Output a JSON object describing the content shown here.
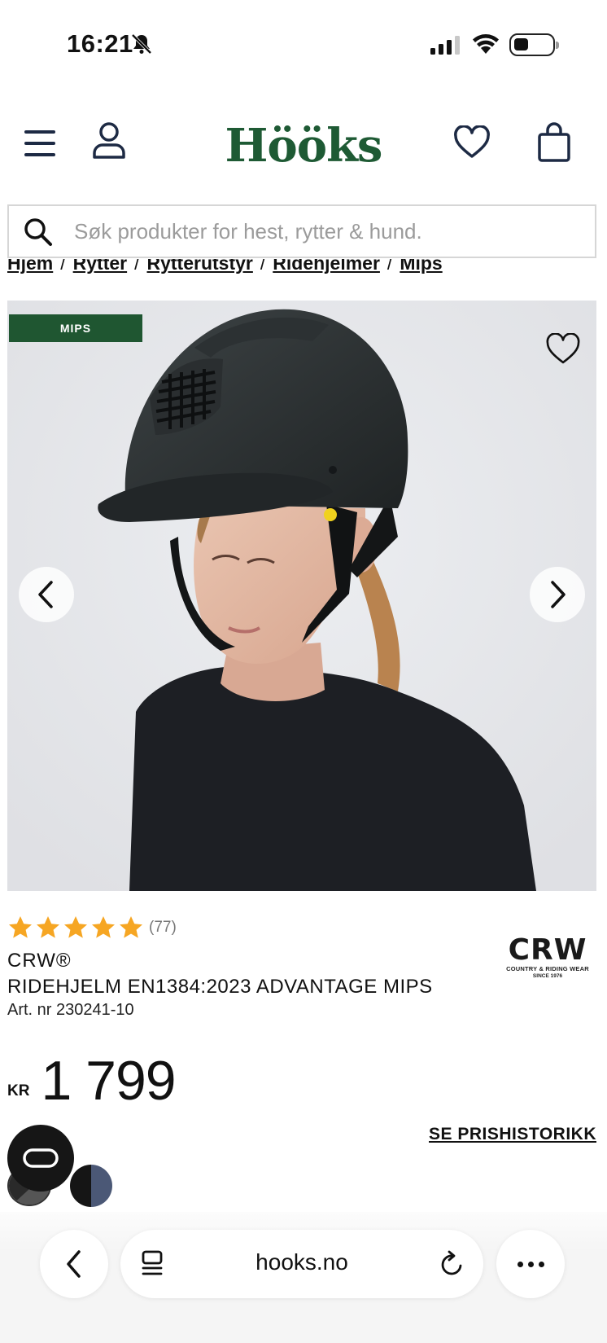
{
  "status_bar": {
    "time": "16:21"
  },
  "header": {
    "logo": "Hööks",
    "brand_color": "#1e5a34"
  },
  "search": {
    "placeholder": "Søk produkter for hest, rytter & hund.",
    "value": ""
  },
  "breadcrumb": [
    "Hjem",
    "Rytter",
    "Rytterutstyr",
    "Ridehjelmer",
    "Mips"
  ],
  "product": {
    "badge": "MIPS",
    "badge_color": "#1f5631",
    "rating_stars": 5,
    "star_color": "#f6a623",
    "review_count": "(77)",
    "brand": "CRW®",
    "title": "RIDEHJELM EN1384:2023 ADVANTAGE MIPS",
    "article_number": "Art. nr 230241-10",
    "price_currency": "KR",
    "price_value": "1 799",
    "price_history_link": "SE PRISHISTORIKK",
    "brand_logo": {
      "mark": "CRW",
      "sub": "COUNTRY & RIDING WEAR",
      "since": "SINCE 1976"
    },
    "swatches": [
      "black",
      "black/navy"
    ]
  },
  "icons": {
    "menu": "menu-icon",
    "account": "account-icon",
    "wishlist": "heart-icon",
    "bag": "shopping-bag-icon",
    "search": "search-icon",
    "prev": "chevron-left-icon",
    "next": "chevron-right-icon",
    "chat": "chat-icon"
  },
  "browser": {
    "url": "hooks.no"
  }
}
